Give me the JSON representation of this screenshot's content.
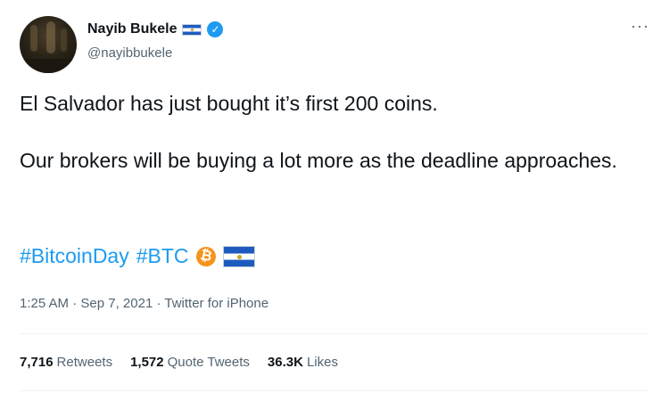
{
  "author": {
    "display_name": "Nayib Bukele",
    "handle": "@nayibbukele",
    "verified_icon": "verified-badge-icon",
    "flag_icon": "el-salvador-flag-icon"
  },
  "more_icon": "more-options-icon",
  "tweet": {
    "line1": "El Salvador has just bought it’s first 200 coins.",
    "line2": "Our brokers will be buying a lot more as the deadline approaches.",
    "hashtag1": "#BitcoinDay",
    "hashtag2": "#BTC",
    "btc_icon": "bitcoin-icon",
    "btc_symbol": "₿"
  },
  "meta": {
    "time": "1:25 AM",
    "sep1": " · ",
    "date": "Sep 7, 2021",
    "sep2": " · ",
    "source": "Twitter for iPhone"
  },
  "stats": {
    "retweets_count": "7,716",
    "retweets_label": "Retweets",
    "quotes_count": "1,572",
    "quotes_label": "Quote Tweets",
    "likes_count": "36.3K",
    "likes_label": "Likes"
  },
  "colors": {
    "link": "#1d9bf0",
    "secondary_text": "#536471",
    "primary_text": "#0f1419",
    "bitcoin": "#f7931a"
  }
}
